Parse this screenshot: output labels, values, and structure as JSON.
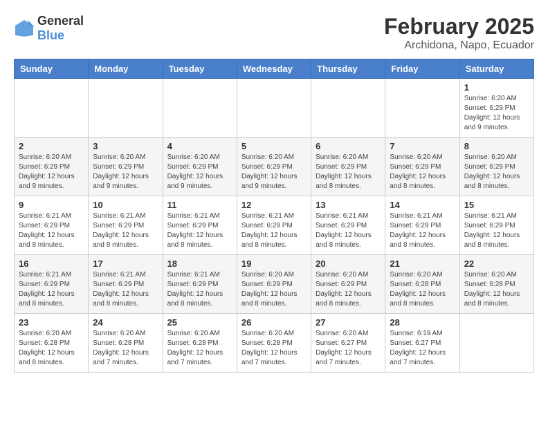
{
  "logo": {
    "general": "General",
    "blue": "Blue"
  },
  "title": "February 2025",
  "subtitle": "Archidona, Napo, Ecuador",
  "days_of_week": [
    "Sunday",
    "Monday",
    "Tuesday",
    "Wednesday",
    "Thursday",
    "Friday",
    "Saturday"
  ],
  "weeks": [
    [
      {
        "day": "",
        "info": ""
      },
      {
        "day": "",
        "info": ""
      },
      {
        "day": "",
        "info": ""
      },
      {
        "day": "",
        "info": ""
      },
      {
        "day": "",
        "info": ""
      },
      {
        "day": "",
        "info": ""
      },
      {
        "day": "1",
        "info": "Sunrise: 6:20 AM\nSunset: 6:29 PM\nDaylight: 12 hours and 9 minutes."
      }
    ],
    [
      {
        "day": "2",
        "info": "Sunrise: 6:20 AM\nSunset: 6:29 PM\nDaylight: 12 hours and 9 minutes."
      },
      {
        "day": "3",
        "info": "Sunrise: 6:20 AM\nSunset: 6:29 PM\nDaylight: 12 hours and 9 minutes."
      },
      {
        "day": "4",
        "info": "Sunrise: 6:20 AM\nSunset: 6:29 PM\nDaylight: 12 hours and 9 minutes."
      },
      {
        "day": "5",
        "info": "Sunrise: 6:20 AM\nSunset: 6:29 PM\nDaylight: 12 hours and 9 minutes."
      },
      {
        "day": "6",
        "info": "Sunrise: 6:20 AM\nSunset: 6:29 PM\nDaylight: 12 hours and 8 minutes."
      },
      {
        "day": "7",
        "info": "Sunrise: 6:20 AM\nSunset: 6:29 PM\nDaylight: 12 hours and 8 minutes."
      },
      {
        "day": "8",
        "info": "Sunrise: 6:20 AM\nSunset: 6:29 PM\nDaylight: 12 hours and 8 minutes."
      }
    ],
    [
      {
        "day": "9",
        "info": "Sunrise: 6:21 AM\nSunset: 6:29 PM\nDaylight: 12 hours and 8 minutes."
      },
      {
        "day": "10",
        "info": "Sunrise: 6:21 AM\nSunset: 6:29 PM\nDaylight: 12 hours and 8 minutes."
      },
      {
        "day": "11",
        "info": "Sunrise: 6:21 AM\nSunset: 6:29 PM\nDaylight: 12 hours and 8 minutes."
      },
      {
        "day": "12",
        "info": "Sunrise: 6:21 AM\nSunset: 6:29 PM\nDaylight: 12 hours and 8 minutes."
      },
      {
        "day": "13",
        "info": "Sunrise: 6:21 AM\nSunset: 6:29 PM\nDaylight: 12 hours and 8 minutes."
      },
      {
        "day": "14",
        "info": "Sunrise: 6:21 AM\nSunset: 6:29 PM\nDaylight: 12 hours and 8 minutes."
      },
      {
        "day": "15",
        "info": "Sunrise: 6:21 AM\nSunset: 6:29 PM\nDaylight: 12 hours and 8 minutes."
      }
    ],
    [
      {
        "day": "16",
        "info": "Sunrise: 6:21 AM\nSunset: 6:29 PM\nDaylight: 12 hours and 8 minutes."
      },
      {
        "day": "17",
        "info": "Sunrise: 6:21 AM\nSunset: 6:29 PM\nDaylight: 12 hours and 8 minutes."
      },
      {
        "day": "18",
        "info": "Sunrise: 6:21 AM\nSunset: 6:29 PM\nDaylight: 12 hours and 8 minutes."
      },
      {
        "day": "19",
        "info": "Sunrise: 6:20 AM\nSunset: 6:29 PM\nDaylight: 12 hours and 8 minutes."
      },
      {
        "day": "20",
        "info": "Sunrise: 6:20 AM\nSunset: 6:29 PM\nDaylight: 12 hours and 8 minutes."
      },
      {
        "day": "21",
        "info": "Sunrise: 6:20 AM\nSunset: 6:28 PM\nDaylight: 12 hours and 8 minutes."
      },
      {
        "day": "22",
        "info": "Sunrise: 6:20 AM\nSunset: 6:28 PM\nDaylight: 12 hours and 8 minutes."
      }
    ],
    [
      {
        "day": "23",
        "info": "Sunrise: 6:20 AM\nSunset: 6:28 PM\nDaylight: 12 hours and 8 minutes."
      },
      {
        "day": "24",
        "info": "Sunrise: 6:20 AM\nSunset: 6:28 PM\nDaylight: 12 hours and 7 minutes."
      },
      {
        "day": "25",
        "info": "Sunrise: 6:20 AM\nSunset: 6:28 PM\nDaylight: 12 hours and 7 minutes."
      },
      {
        "day": "26",
        "info": "Sunrise: 6:20 AM\nSunset: 6:28 PM\nDaylight: 12 hours and 7 minutes."
      },
      {
        "day": "27",
        "info": "Sunrise: 6:20 AM\nSunset: 6:27 PM\nDaylight: 12 hours and 7 minutes."
      },
      {
        "day": "28",
        "info": "Sunrise: 6:19 AM\nSunset: 6:27 PM\nDaylight: 12 hours and 7 minutes."
      },
      {
        "day": "",
        "info": ""
      }
    ]
  ]
}
